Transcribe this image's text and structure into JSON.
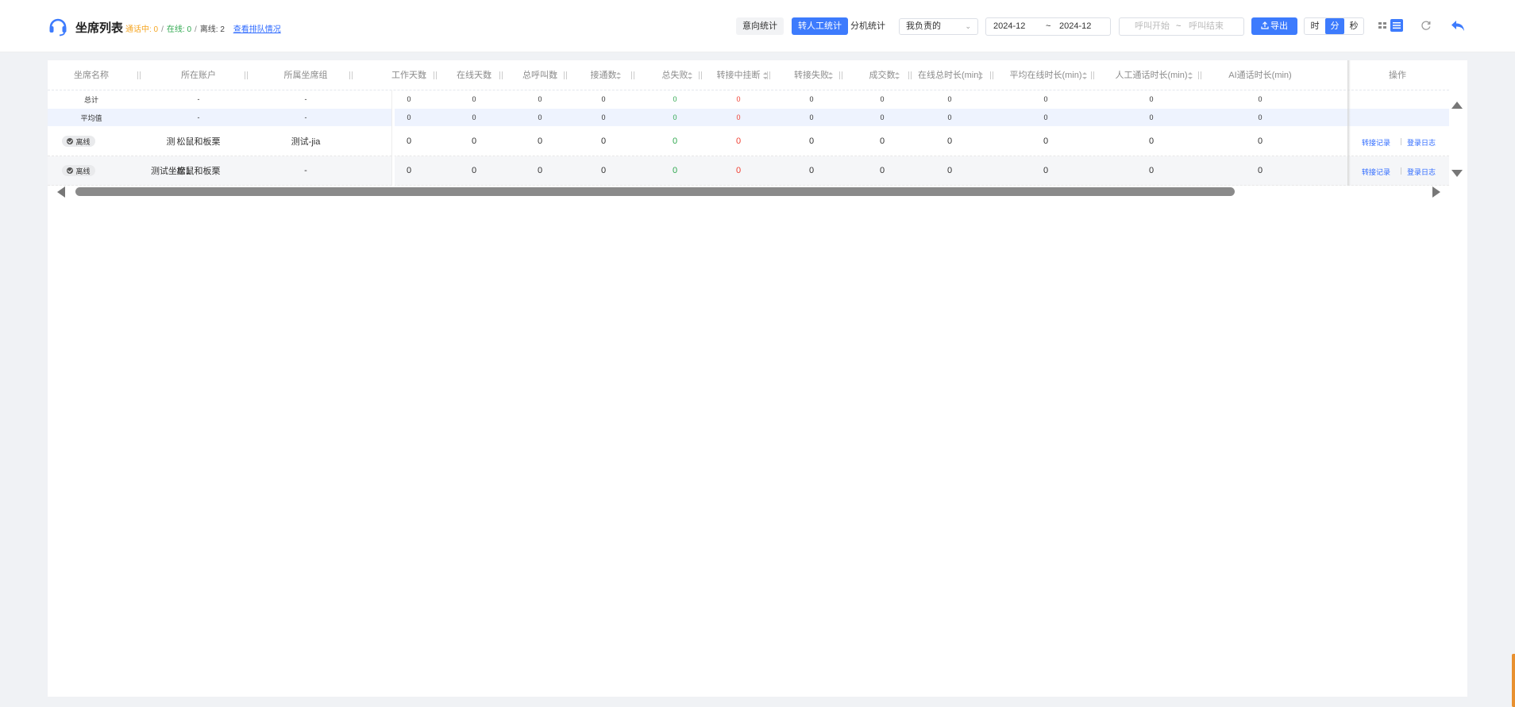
{
  "header": {
    "title": "坐席列表",
    "status": {
      "calling_label": "通话中: 0",
      "online_label": "在线: 0",
      "offline_label": "离线: 2",
      "separator": "/",
      "queue_link": "查看排队情况"
    },
    "tabs": [
      {
        "label": "意向统计",
        "active": false
      },
      {
        "label": "转人工统计",
        "active": true
      },
      {
        "label": "分机统计",
        "active": false
      }
    ],
    "scope_select": "我负责的",
    "date_start": "2024-12",
    "date_sep": "~",
    "date_end": "2024-12",
    "call_start_placeholder": "呼叫开始",
    "call_end_placeholder": "呼叫结束",
    "export_label": "导出",
    "units": [
      {
        "label": "时",
        "active": false
      },
      {
        "label": "分",
        "active": true
      },
      {
        "label": "秒",
        "active": false
      }
    ],
    "accent_color": "#3d7bfd"
  },
  "table": {
    "columns": [
      {
        "label": "坐席名称",
        "sortable": false
      },
      {
        "label": "所在账户",
        "sortable": false
      },
      {
        "label": "所属坐席组",
        "sortable": false
      },
      {
        "label": "工作天数",
        "sortable": true
      },
      {
        "label": "在线天数",
        "sortable": true
      },
      {
        "label": "总呼叫数",
        "sortable": true
      },
      {
        "label": "接通数",
        "sortable": true
      },
      {
        "label": "总失败",
        "sortable": true
      },
      {
        "label": "转接中挂断",
        "sortable": true
      },
      {
        "label": "转接失败",
        "sortable": true
      },
      {
        "label": "成交数",
        "sortable": true
      },
      {
        "label": "在线总时长(min)",
        "sortable": true
      },
      {
        "label": "平均在线时长(min)",
        "sortable": true
      },
      {
        "label": "人工通话时长(min)",
        "sortable": true
      },
      {
        "label": "AI通话时长(min)",
        "sortable": false
      },
      {
        "label": "操作",
        "sortable": false
      }
    ],
    "summary_rows": [
      {
        "name": "总计",
        "account": "-",
        "group": "-",
        "values": [
          "0",
          "0",
          "0",
          "0",
          "0",
          "0",
          "0",
          "0",
          "0",
          "0",
          "0",
          "0"
        ]
      },
      {
        "name": "平均值",
        "account": "-",
        "group": "-",
        "values": [
          "0",
          "0",
          "0",
          "0",
          "0",
          "0",
          "0",
          "0",
          "0",
          "0",
          "0",
          "0"
        ]
      }
    ],
    "rows": [
      {
        "status": "离线",
        "name": "测",
        "account": "松鼠和板栗",
        "group": "测试-jia",
        "values": [
          "0",
          "0",
          "0",
          "0",
          "0",
          "0",
          "0",
          "0",
          "0",
          "0",
          "0",
          "0"
        ],
        "actions": [
          "转接记录",
          "登录日志"
        ]
      },
      {
        "status": "离线",
        "name": "测试坐席1",
        "account": "松鼠和板栗",
        "group": "-",
        "values": [
          "0",
          "0",
          "0",
          "0",
          "0",
          "0",
          "0",
          "0",
          "0",
          "0",
          "0",
          "0"
        ],
        "actions": [
          "转接记录",
          "登录日志"
        ]
      }
    ],
    "value_colors": {
      "connected": "#2fa84f",
      "failed": "#f04134"
    }
  }
}
